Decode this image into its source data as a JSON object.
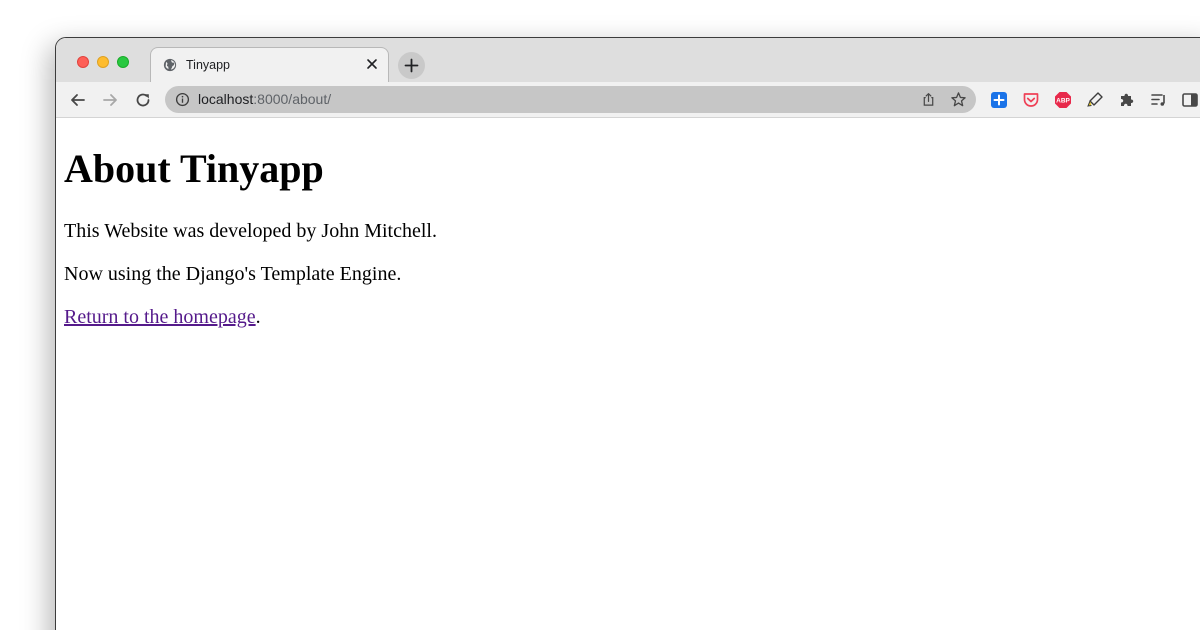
{
  "browser": {
    "tab": {
      "title": "Tinyapp",
      "favicon": "globe-icon"
    },
    "address_bar": {
      "host": "localhost",
      "path": ":8000/about/"
    },
    "extensions": [
      "plus-square-icon",
      "pocket-icon",
      "adblock-icon",
      "highlighter-icon",
      "puzzle-icon",
      "reading-list-icon",
      "side-panel-icon"
    ],
    "colors": {
      "traffic_close": "#fe5f57",
      "traffic_minimize": "#febc2e",
      "traffic_maximize": "#28c840",
      "visited_link": "#551a8b"
    }
  },
  "page": {
    "heading": "About Tinyapp",
    "paragraphs": [
      "This Website was developed by John Mitchell.",
      "Now using the Django's Template Engine."
    ],
    "link": {
      "text": "Return to the homepage",
      "suffix": "."
    }
  }
}
